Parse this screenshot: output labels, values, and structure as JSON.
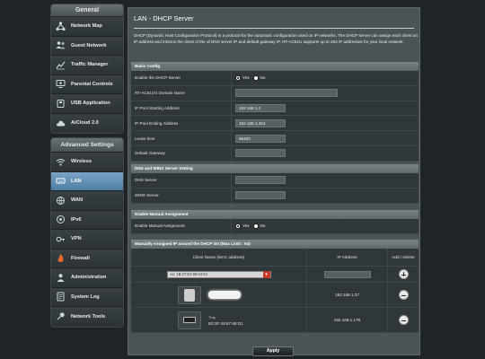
{
  "sidebar": {
    "general_title": "General",
    "general_items": [
      {
        "label": "Network Map",
        "icon": "network-map-icon"
      },
      {
        "label": "Guest Network",
        "icon": "guest-network-icon"
      },
      {
        "label": "Traffic Manager",
        "icon": "traffic-manager-icon"
      },
      {
        "label": "Parental Controls",
        "icon": "parental-controls-icon"
      },
      {
        "label": "USB Application",
        "icon": "usb-application-icon"
      },
      {
        "label": "AiCloud 2.0",
        "icon": "aicloud-icon"
      }
    ],
    "advanced_title": "Advanced Settings",
    "advanced_items": [
      {
        "label": "Wireless",
        "icon": "wireless-icon"
      },
      {
        "label": "LAN",
        "icon": "lan-icon",
        "active": true
      },
      {
        "label": "WAN",
        "icon": "wan-icon"
      },
      {
        "label": "IPv6",
        "icon": "ipv6-icon"
      },
      {
        "label": "VPN",
        "icon": "vpn-icon"
      },
      {
        "label": "Firewall",
        "icon": "firewall-icon"
      },
      {
        "label": "Administration",
        "icon": "administration-icon"
      },
      {
        "label": "System Log",
        "icon": "system-log-icon"
      },
      {
        "label": "Network Tools",
        "icon": "network-tools-icon"
      }
    ]
  },
  "main": {
    "title": "LAN - DHCP Server",
    "description": "DHCP (Dynamic Host Configuration Protocol) is a protocol for the automatic configuration used on IP networks. The DHCP server can assign each client an IP address and informs the client of the of DNS server IP and default gateway IP. RT-AC51U supports up to 253 IP addresses for your local network."
  },
  "basic_config": {
    "title": "Basic Config",
    "enable_dhcp_label": "Enable the DHCP Server",
    "yes": "Yes",
    "no": "No",
    "enable_dhcp_value": "yes",
    "domain_label": "RT-AC51U's Domain Name",
    "domain_value": "",
    "start_label": "IP Pool Starting Address",
    "start_value": "192.168.1.2",
    "end_label": "IP Pool Ending Address",
    "end_value": "192.168.1.254",
    "lease_label": "Lease time",
    "lease_value": "86400",
    "gateway_label": "Default Gateway",
    "gateway_value": ""
  },
  "dns_wins": {
    "title": "DNS and WINS Server Setting",
    "dns_label": "DNS Server",
    "dns_value": "",
    "wins_label": "WINS Server",
    "wins_value": ""
  },
  "manual": {
    "title": "Enable Manual Assignment",
    "label": "Enable Manual Assignment",
    "yes": "Yes",
    "no": "No",
    "value": "yes"
  },
  "manual_list": {
    "title": "Manually Assigned IP around the DHCP list (Max Limit : 64)",
    "col_client": "Client Name (MAC address)",
    "col_ip": "IP Address",
    "col_action": "Add / Delete",
    "select_value": "ex: 1B:27:E4:96:54:94",
    "rows": [
      {
        "name": "",
        "mac": "",
        "ip": "192.168.1.37",
        "device": "phone"
      },
      {
        "name": "Tray",
        "mac": "E0:3F:49:57:48:D1",
        "ip": "192.168.1.176",
        "device": "router"
      }
    ]
  },
  "apply_label": "Apply"
}
